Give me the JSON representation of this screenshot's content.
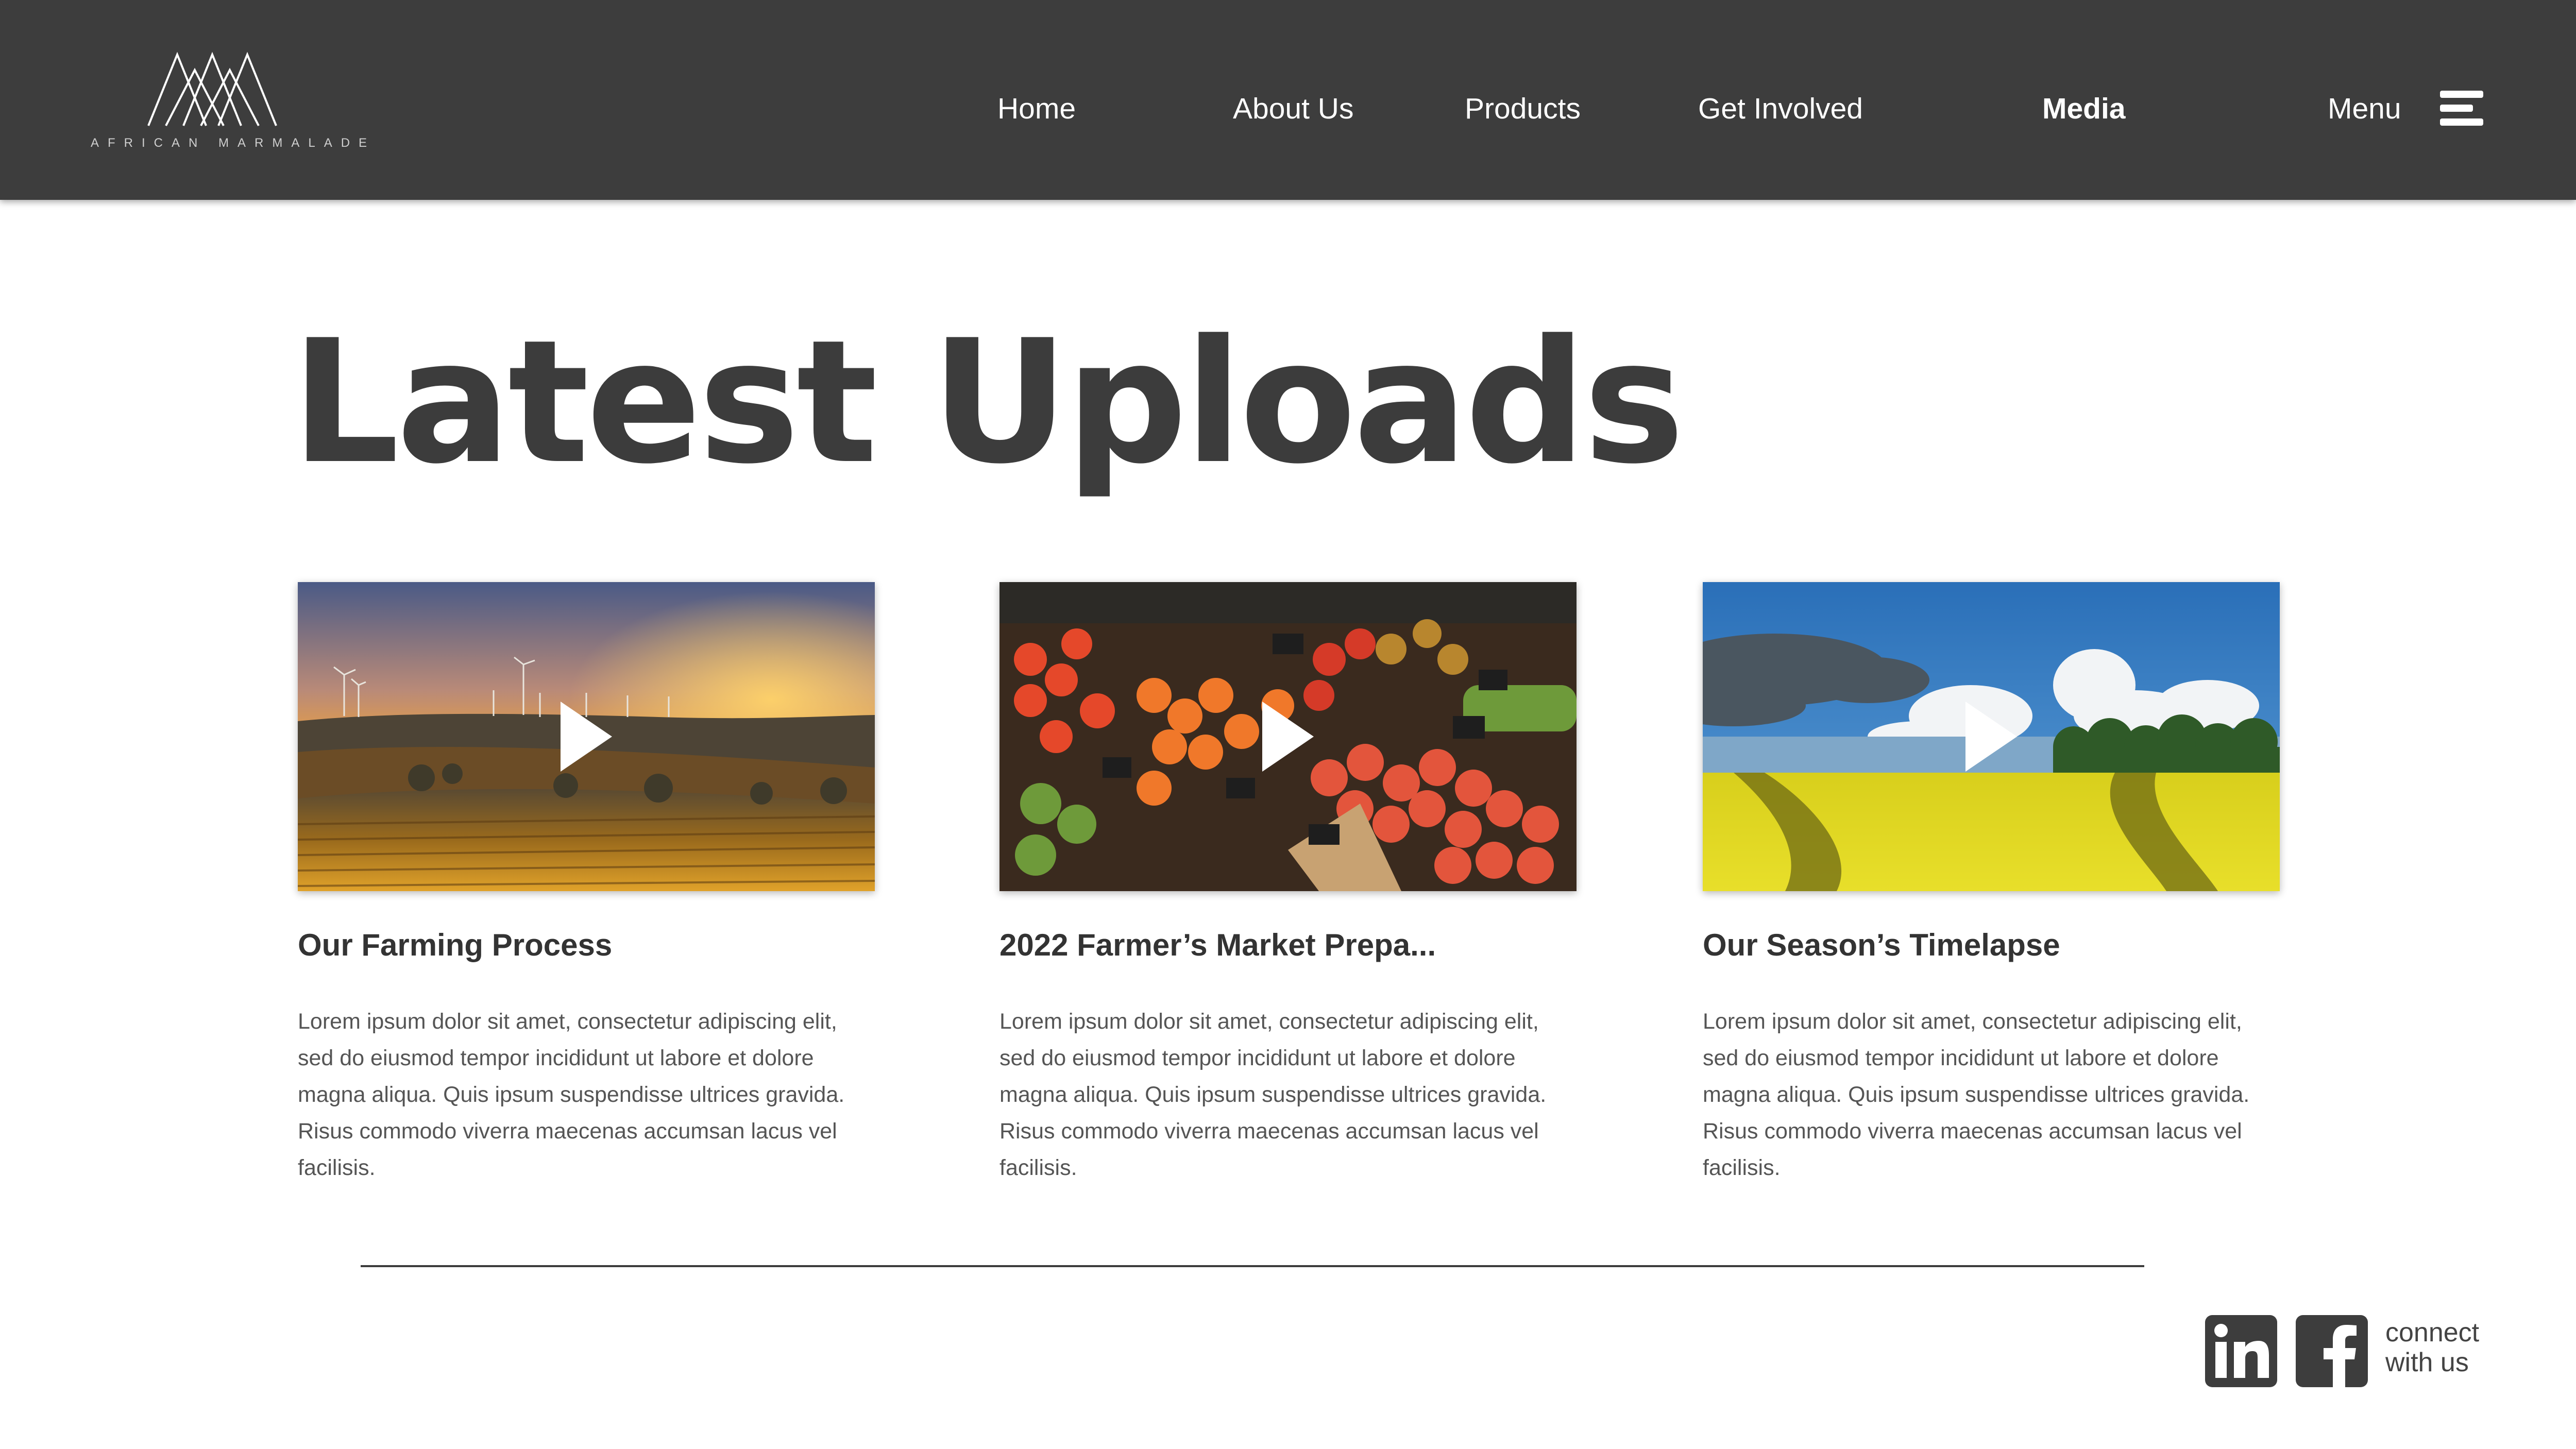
{
  "brand": {
    "logo_text": "AFRICAN MARMALADE"
  },
  "nav": {
    "items": [
      {
        "label": "Home",
        "active": false
      },
      {
        "label": "About Us",
        "active": false
      },
      {
        "label": "Products",
        "active": false
      },
      {
        "label": "Get Involved",
        "active": false
      },
      {
        "label": "Media",
        "active": true
      }
    ],
    "menu_label": "Menu",
    "menu_icon": "hamburger-icon"
  },
  "page": {
    "title": "Latest Uploads"
  },
  "videos": [
    {
      "title": "Our Farming Process",
      "description": "Lorem ipsum dolor sit amet, consectetur adipiscing elit, sed do eiusmod tempor incididunt ut labore et dolore magna aliqua. Quis ipsum suspendisse ultrices gravida. Risus commodo viverra maecenas accumsan lacus vel facilisis.",
      "thumbnail": "sunset-farmland-with-wind-turbines",
      "icon": "play-icon"
    },
    {
      "title": "2022 Farmer’s Market Prepa...",
      "description": "Lorem ipsum dolor sit amet, consectetur adipiscing elit, sed do eiusmod tempor incididunt ut labore et dolore magna aliqua. Quis ipsum suspendisse ultrices gravida. Risus commodo viverra maecenas accumsan lacus vel facilisis.",
      "thumbnail": "market-stall-fruit-baskets",
      "icon": "play-icon"
    },
    {
      "title": "Our Season’s Timelapse",
      "description": "Lorem ipsum dolor sit amet, consectetur adipiscing elit, sed do eiusmod tempor incididunt ut labore et dolore magna aliqua. Quis ipsum suspendisse ultrices gravida. Risus commodo viverra maecenas accumsan lacus vel facilisis.",
      "thumbnail": "yellow-rapeseed-field-blue-sky",
      "icon": "play-icon"
    }
  ],
  "footer": {
    "connect_line1": "connect",
    "connect_line2": "with us",
    "social": [
      "linkedin-icon",
      "facebook-icon"
    ]
  },
  "colors": {
    "header_bg": "#3d3d3d",
    "text_dark": "#3c3c3c",
    "text_body": "#555555"
  }
}
